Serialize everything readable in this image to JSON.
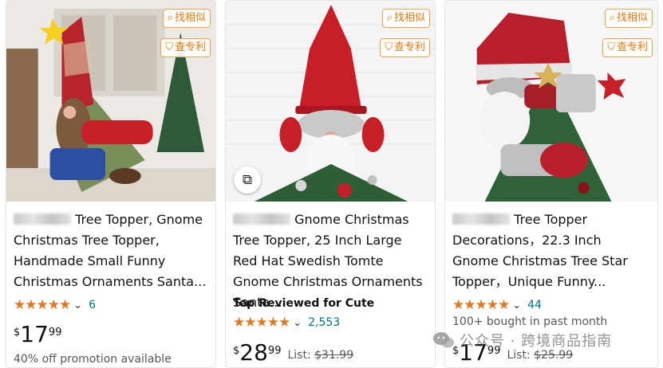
{
  "tools": {
    "find_similar": "找相似",
    "check_patent": "查专利"
  },
  "products": [
    {
      "title_visible": "Tree Topper, Gnome Christmas Tree Topper, Handmade Small Funny Christmas Ornaments Santa...",
      "rating_stars": 5,
      "review_count": "6",
      "price": {
        "symbol": "$",
        "whole": "17",
        "fraction": "99"
      },
      "promotion": "40% off promotion available"
    },
    {
      "title_visible": "Gnome Christmas Tree Topper, 25 Inch Large Red Hat Swedish Tomte Gnome Christmas Ornaments Santa...",
      "badge": "Top Reviewed for Cute",
      "rating_stars": 5,
      "review_count": "2,553",
      "price": {
        "symbol": "$",
        "whole": "28",
        "fraction": "99"
      },
      "list_label": "List:",
      "list_price": "$31.99"
    },
    {
      "title_visible": "Tree Topper Decorations，22.3 Inch Gnome Christmas Tree Star Topper，Unique Funny...",
      "rating_stars": 5,
      "review_count": "44",
      "bought": "100+ bought in past month",
      "price": {
        "symbol": "$",
        "whole": "17",
        "fraction": "99"
      },
      "list_label": "List:",
      "list_price": "$25.99"
    }
  ],
  "watermark": "公众号 · 跨境商品指南",
  "colors": {
    "star": "#de7921",
    "link": "#007185",
    "tool_border": "#f0a050",
    "tool_text": "#e47911"
  }
}
